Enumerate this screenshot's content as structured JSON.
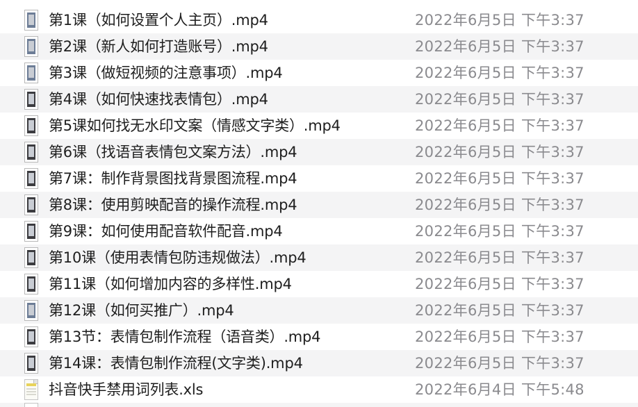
{
  "files": [
    {
      "name": "第1课（如何设置个人主页）.mp4",
      "date": "2022年6月5日 下午3:37",
      "icon": "video-thumbnail-icon"
    },
    {
      "name": "第2课（新人如何打造账号）.mp4",
      "date": "2022年6月5日 下午3:37",
      "icon": "video-thumbnail-icon"
    },
    {
      "name": "第3课（做短视频的注意事项）.mp4",
      "date": "2022年6月5日 下午3:37",
      "icon": "video-thumbnail-icon"
    },
    {
      "name": "第4课（如何快速找表情包）.mp4",
      "date": "2022年6月5日 下午3:37",
      "icon": "video-thumbnail-icon"
    },
    {
      "name": "第5课如何找无水印文案（情感文字类）.mp4",
      "date": "2022年6月5日 下午3:37",
      "icon": "video-thumbnail-icon"
    },
    {
      "name": "第6课（找语音表情包文案方法）.mp4",
      "date": "2022年6月5日 下午3:37",
      "icon": "video-thumbnail-icon"
    },
    {
      "name": "第7课：制作背景图找背景图流程.mp4",
      "date": "2022年6月5日 下午3:37",
      "icon": "video-thumbnail-icon"
    },
    {
      "name": "第8课：使用剪映配音的操作流程.mp4",
      "date": "2022年6月5日 下午3:37",
      "icon": "video-thumbnail-icon"
    },
    {
      "name": "第9课：如何使用配音软件配音.mp4",
      "date": "2022年6月5日 下午3:37",
      "icon": "video-thumbnail-icon"
    },
    {
      "name": "第10课（使用表情包防违规做法）.mp4",
      "date": "2022年6月5日 下午3:37",
      "icon": "video-thumbnail-icon"
    },
    {
      "name": "第11课（如何增加内容的多样性.mp4",
      "date": "2022年6月5日 下午3:37",
      "icon": "video-thumbnail-icon"
    },
    {
      "name": "第12课（如何买推广）.mp4",
      "date": "2022年6月5日 下午3:37",
      "icon": "video-thumbnail-icon"
    },
    {
      "name": "第13节：表情包制作流程（语音类）.mp4",
      "date": "2022年6月5日 下午3:37",
      "icon": "video-thumbnail-icon"
    },
    {
      "name": "第14课：表情包制作流程(文字类).mp4",
      "date": "2022年6月5日 下午3:37",
      "icon": "video-thumbnail-icon"
    },
    {
      "name": "抖音快手禁用词列表.xls",
      "date": "2022年6月4日 下午5:48",
      "icon": "spreadsheet-file-icon"
    }
  ],
  "colors": {
    "row_alt_background": "#f4f4f5",
    "name_text": "#1e1e1e",
    "date_text": "#8a8a8e"
  }
}
